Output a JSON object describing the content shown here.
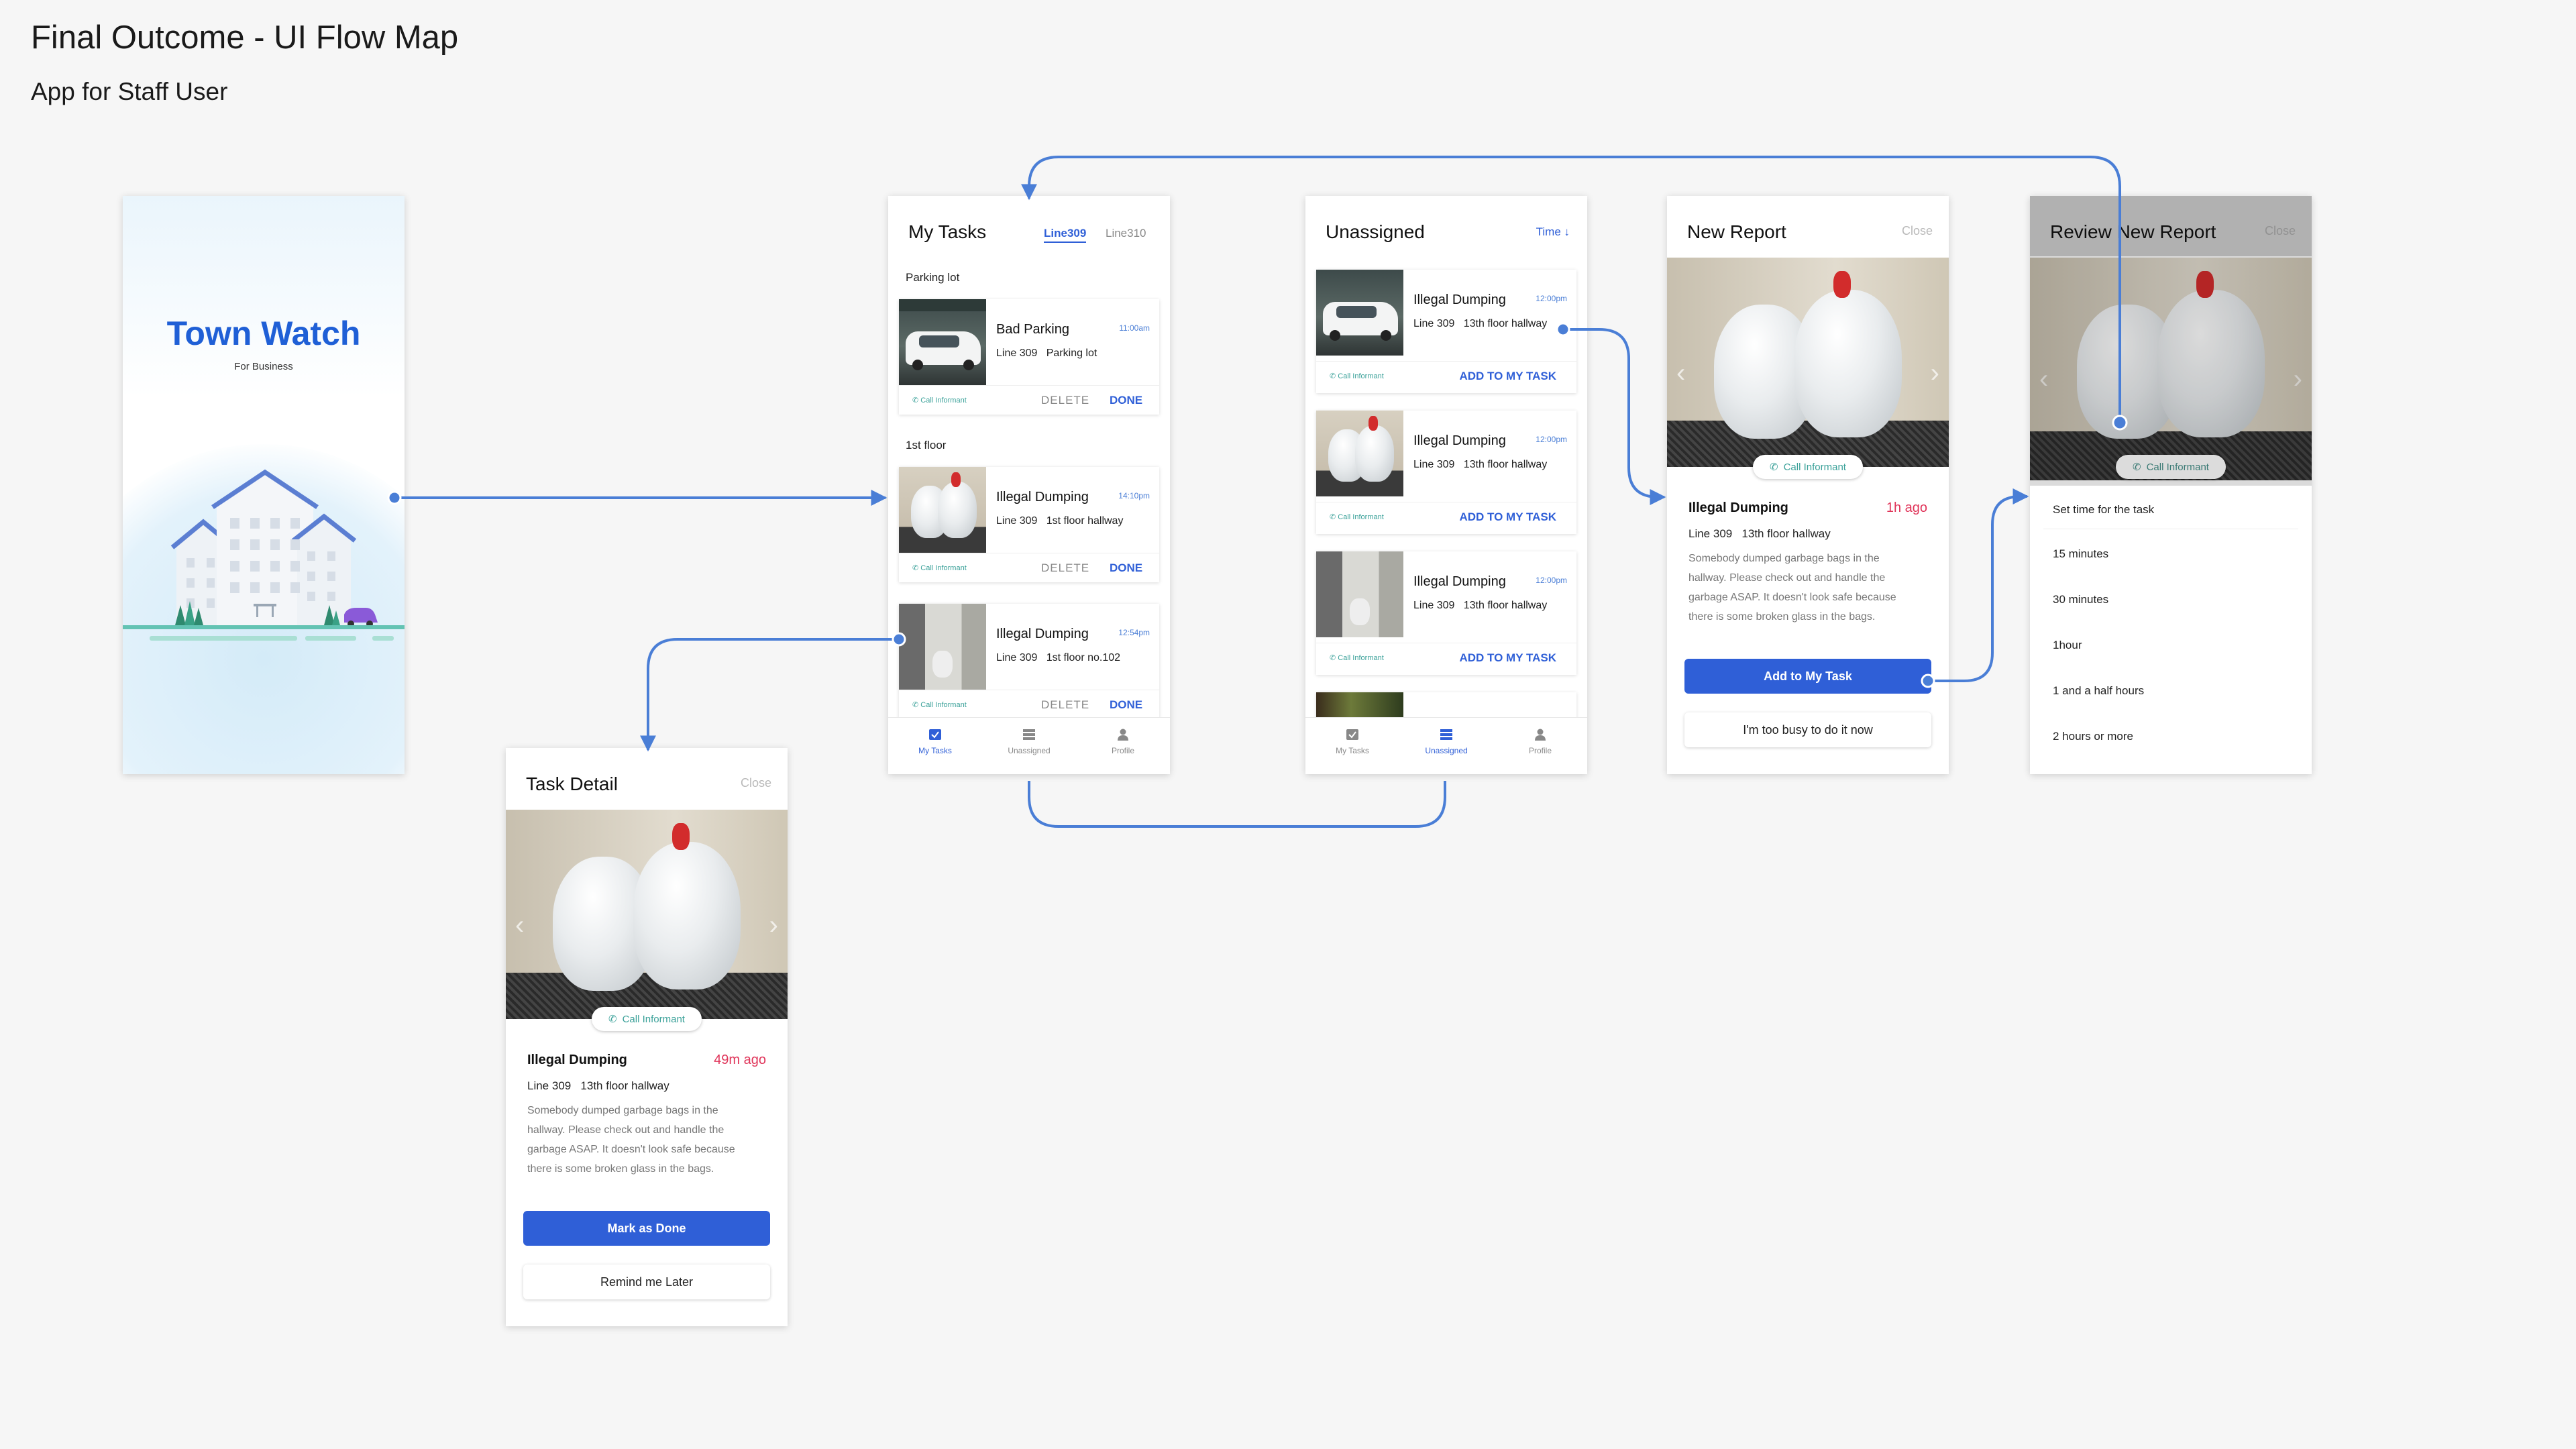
{
  "page": {
    "title": "Final Outcome - UI Flow Map",
    "subtitle": "App for Staff User"
  },
  "colors": {
    "brand_blue": "#2f5fd7",
    "connector": "#4a7ed6",
    "teal": "#3aa199",
    "alert_red": "#e0355a"
  },
  "splash": {
    "brand": "Town Watch",
    "tagline": "For Business"
  },
  "my_tasks": {
    "title": "My Tasks",
    "tabs": [
      "Line309",
      "Line310"
    ],
    "sections": [
      {
        "label": "Parking lot",
        "cards": [
          {
            "title": "Bad Parking",
            "time": "11:00am",
            "line": "Line 309",
            "location": "Parking lot",
            "informant": "Call Informant",
            "delete": "DELETE",
            "done": "DONE"
          }
        ]
      },
      {
        "label": "1st floor",
        "cards": [
          {
            "title": "Illegal Dumping",
            "time": "14:10pm",
            "line": "Line 309",
            "location": "1st floor hallway",
            "informant": "Call Informant",
            "delete": "DELETE",
            "done": "DONE"
          },
          {
            "title": "Illegal Dumping",
            "time": "12:54pm",
            "line": "Line 309",
            "location": "1st floor no.102",
            "informant": "Call Informant",
            "delete": "DELETE",
            "done": "DONE"
          }
        ]
      }
    ]
  },
  "unassigned": {
    "title": "Unassigned",
    "sort": "Time ↓",
    "cards": [
      {
        "title": "Illegal Dumping",
        "time": "12:00pm",
        "line": "Line 309",
        "location": "13th floor hallway",
        "informant": "Call Informant",
        "action": "ADD TO MY TASK"
      },
      {
        "title": "Illegal Dumping",
        "time": "12:00pm",
        "line": "Line 309",
        "location": "13th floor hallway",
        "informant": "Call Informant",
        "action": "ADD TO MY TASK"
      },
      {
        "title": "Illegal Dumping",
        "time": "12:00pm",
        "line": "Line 309",
        "location": "13th floor hallway",
        "informant": "Call Informant",
        "action": "ADD TO MY TASK"
      }
    ]
  },
  "tabbar": [
    "My Tasks",
    "Unassigned",
    "Profile"
  ],
  "new_report": {
    "title": "New Report",
    "close": "Close",
    "informant": "Call Informant",
    "report_title": "Illegal Dumping",
    "age": "1h ago",
    "line": "Line 309",
    "location": "13th floor hallway",
    "description": [
      "Somebody dumped garbage bags in the",
      "hallway. Please check out and handle the",
      "garbage ASAP. It doesn't look safe because",
      "there is some broken glass in the bags."
    ],
    "primary": "Add to My Task",
    "secondary": "I'm too busy to do it now"
  },
  "review": {
    "title": "Review New Report",
    "close": "Close",
    "informant": "Call Informant",
    "sheet_title": "Set time for the task",
    "options": [
      "15 minutes",
      "30 minutes",
      "1hour",
      "1 and a half hours",
      "2 hours or more"
    ]
  },
  "task_detail": {
    "title": "Task Detail",
    "close": "Close",
    "informant": "Call Informant",
    "report_title": "Illegal Dumping",
    "age": "49m ago",
    "line": "Line 309",
    "location": "13th floor hallway",
    "description": [
      "Somebody dumped garbage bags in the",
      "hallway. Please check out and handle the",
      "garbage ASAP. It doesn't look safe because",
      "there is some broken glass in the bags."
    ],
    "primary": "Mark as Done",
    "secondary": "Remind me Later"
  }
}
